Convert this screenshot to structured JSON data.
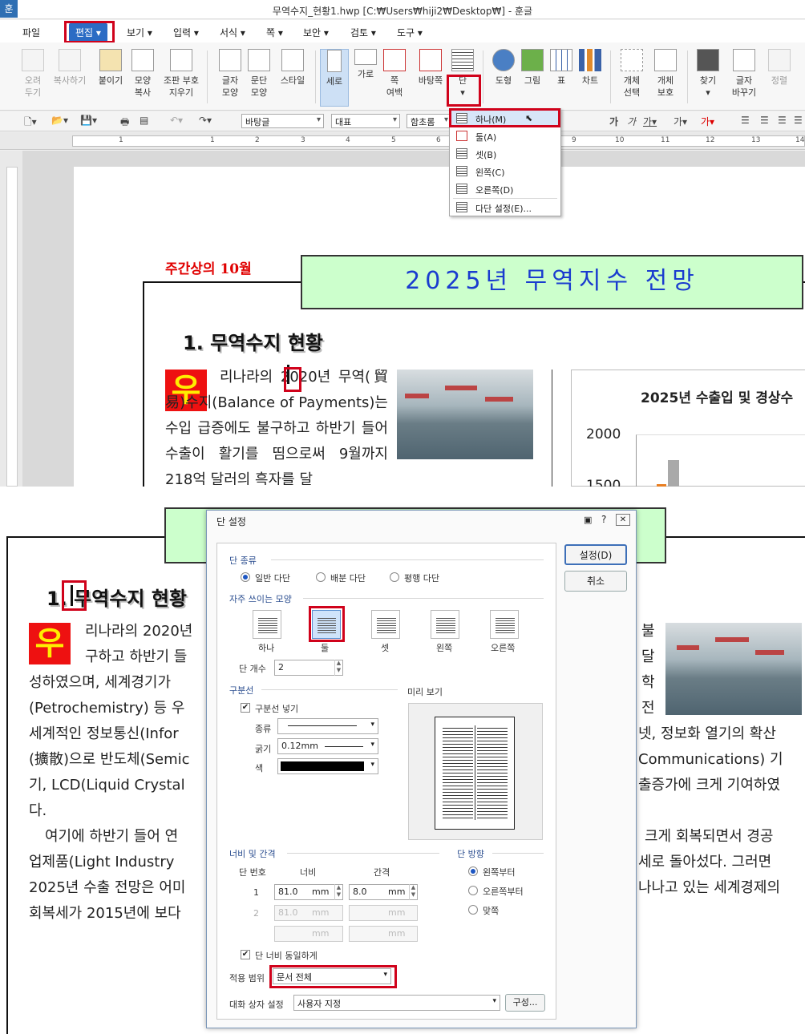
{
  "window_title": "무역수지_현황1.hwp [C:₩Users₩hiji2₩Desktop₩] - 훈글",
  "app_logo": "훈",
  "menu": [
    "파일",
    "편집",
    "보기",
    "입력",
    "서식",
    "쪽",
    "보안",
    "검토",
    "도구"
  ],
  "ribbon": {
    "cut": "오려\n두기",
    "copy": "복사하기",
    "paste": "붙이기",
    "shape_copy": "모양\n복사",
    "clear_codes": "조판 부호\n지우기",
    "char_shape": "글자\n모양",
    "para_shape": "문단\n모양",
    "style": "스타일",
    "vertical": "세로",
    "horizontal": "가로",
    "page_margin": "쪽\n여백",
    "background": "바탕쪽",
    "columns": "단",
    "shape": "도형",
    "picture": "그림",
    "table": "표",
    "chart": "차트",
    "obj_select": "개체\n선택",
    "obj_protect": "개체\n보호",
    "find": "찾기",
    "char_replace": "글자\n바꾸기",
    "sort": "정렬"
  },
  "toolbar2": {
    "font_lang": "바탕글",
    "font_repr": "대표",
    "font_name": "함초롬"
  },
  "ruler_numbers": [
    "1",
    "1",
    "2",
    "3",
    "4",
    "5",
    "6",
    "9",
    "10",
    "11",
    "12",
    "13",
    "14"
  ],
  "dropdown": {
    "items": [
      "하나(M)",
      "둘(A)",
      "셋(B)",
      "왼쪽(C)",
      "오른쪽(D)",
      "다단 설정(E)..."
    ]
  },
  "doc": {
    "weekly": "주간상의 10월",
    "header": "2025년 무역지수 전망",
    "section_title": "1. 무역수지 현황",
    "red_glyph": "우",
    "para1_top": "리나라의 2020년 무역(貿易)수지(Balance of Payments)는 수입 급증에도 불구하고 하반기 들어 수출이 활기를 띰으로써 9월까지 218억 달러의 흑자를 달",
    "chart_title": "2025년 수출입 및 경상수",
    "chart_ticks": [
      "2000",
      "1500"
    ],
    "bottom_lines": [
      "리나라의 2020년",
      "구하고 하반기 들",
      "성하였으며, 세계경기가",
      "(Petrochemistry) 등 우",
      "세계적인 정보통신(Infor",
      "(擴散)으로 반도체(Semic",
      "기, LCD(Liquid Crystal",
      "다.",
      "여기에 하반기 들어 연",
      "업제품(Light Industry",
      "2025년 수출 전망은 어미",
      "회복세가 2015년에 보다"
    ],
    "bottom_right_lines": [
      "불",
      "달",
      "학",
      "전",
      "넷, 정보화 열기의 확산",
      "Communications) 기",
      "출증가에 크게 기여하였",
      "",
      "크게 회복되면서 경공",
      "세로 돌아섰다. 그러면",
      "나나고 있는 세계경제의",
      ""
    ]
  },
  "dialog": {
    "title": "단 설정",
    "ok": "설정(D)",
    "cancel": "취소",
    "col_type_label": "단 종류",
    "col_types": [
      "일반 다단",
      "배분 다단",
      "평행 다단"
    ],
    "frequent_label": "자주 쓰이는 모양",
    "presets": [
      "하나",
      "둘",
      "셋",
      "왼쪽",
      "오른쪽"
    ],
    "count_label": "단 개수",
    "count_value": "2",
    "divider_label": "구분선",
    "divider_check": "구분선 넣기",
    "type_label": "종류",
    "thickness_label": "굵기",
    "thickness_value": "0.12mm",
    "color_label": "색",
    "preview_label": "미리 보기",
    "width_gap_label": "너비 및 간격",
    "col_num_header": "단 번호",
    "width_header": "너비",
    "gap_header": "간격",
    "row1_num": "1",
    "row1_width": "81.0",
    "row1_gap": "8.0",
    "row2_num": "2",
    "row2_width": "81.0",
    "unit": "mm",
    "direction_label": "단 방향",
    "directions": [
      "왼쪽부터",
      "오른쪽부터",
      "맞쪽"
    ],
    "equal_width": "단 너비 동일하게",
    "apply_label": "적용 범위",
    "apply_value": "문서 전체",
    "dialog_setting_label": "대화 상자 설정",
    "dialog_setting_value": "사용자 지정",
    "config_button": "구성..."
  }
}
